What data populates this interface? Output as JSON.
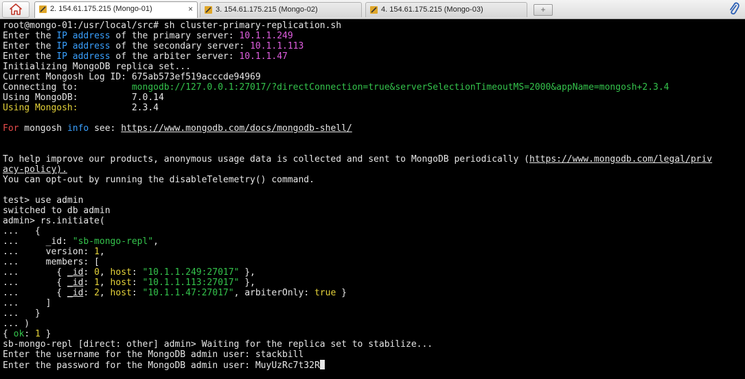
{
  "tabs": [
    {
      "label": "2. 154.61.175.215 (Mongo-01)",
      "active": true,
      "close": "×"
    },
    {
      "label": "3. 154.61.175.215 (Mongo-02)",
      "active": false,
      "close": "×"
    },
    {
      "label": "4. 154.61.175.215 (Mongo-03)",
      "active": false,
      "close": "×"
    }
  ],
  "newtab_label": "+",
  "colors": {
    "text": "#e6e6e6",
    "keyword": "#3aa0ff",
    "ip_value": "#e05ee0",
    "string": "#34c34c",
    "highlight": "#e4d23a",
    "for_keyword": "#e84b4b"
  },
  "terminal": {
    "l1": "root@mongo-01:/usr/local/src# sh cluster-primary-replication.sh",
    "l2": {
      "a": "Enter the ",
      "b": "IP address",
      "c": " of the primary server: ",
      "d": "10.1.1.249"
    },
    "l3": {
      "a": "Enter the ",
      "b": "IP address",
      "c": " of the secondary server: ",
      "d": "10.1.1.113"
    },
    "l4": {
      "a": "Enter the ",
      "b": "IP address",
      "c": " of the arbiter server: ",
      "d": "10.1.1.47"
    },
    "l5": "Initializing MongoDB replica set...",
    "l6": "Current Mongosh Log ID: 675ab573ef519acccde94969",
    "l7": {
      "a": "Connecting to:          ",
      "b": "mongodb://127.0.0.1:27017/?directConnection=true&serverSelectionTimeoutMS=2000&appName=mongosh+2.3.4"
    },
    "l8": {
      "a": "Using MongoDB:          ",
      "b": "7.0.14"
    },
    "l9": {
      "a": "Using Mongosh:",
      "b": "          2.3.4"
    },
    "l10": {
      "a": "For",
      "b": " mongosh ",
      "c": "info",
      "d": " see: ",
      "e": "https://www.mongodb.com/docs/mongodb-shell/"
    },
    "l11": {
      "a": "To help improve our products, anonymous usage data is collected and sent to MongoDB periodically (",
      "b": "https://www.mongodb.com/legal/priv"
    },
    "l12": "acy-policy).",
    "l13": "You can opt-out by running the disableTelemetry() command.",
    "l14": "test> use admin",
    "l15": "switched to db admin",
    "l16": "admin> rs.initiate(",
    "l17": "...   {",
    "l18": {
      "a": "...     _id: ",
      "b": "\"sb-mongo-repl\"",
      "c": ","
    },
    "l19": {
      "a": "...     version: ",
      "b": "1",
      "c": ","
    },
    "l20": "...     members: [",
    "l21": {
      "a": "...       { ",
      "b": "_id",
      "c": ": ",
      "d": "0",
      "e": ", ",
      "f": "host",
      "g": ": ",
      "h": "\"10.1.1.249:27017\"",
      "i": " },"
    },
    "l22": {
      "a": "...       { ",
      "b": "_id",
      "c": ": ",
      "d": "1",
      "e": ", ",
      "f": "host",
      "g": ": ",
      "h": "\"10.1.1.113:27017\"",
      "i": " },"
    },
    "l23": {
      "a": "...       { ",
      "b": "_id",
      "c": ": ",
      "d": "2",
      "e": ", ",
      "f": "host",
      "g": ": ",
      "h": "\"10.1.1.47:27017\"",
      "i": ", arbiterOnly: ",
      "j": "true",
      "k": " }"
    },
    "l24": "...     ]",
    "l25": "...   }",
    "l26": "... )",
    "l27": {
      "a": "{ ",
      "b": "ok",
      "c": ": ",
      "d": "1",
      "e": " }"
    },
    "l28": "sb-mongo-repl [direct: other] admin> Waiting for the replica set to stabilize...",
    "l29": "Enter the username for the MongoDB admin user: stackbill",
    "l30": "Enter the password for the MongoDB admin user: MuyUzRc7t32R"
  }
}
